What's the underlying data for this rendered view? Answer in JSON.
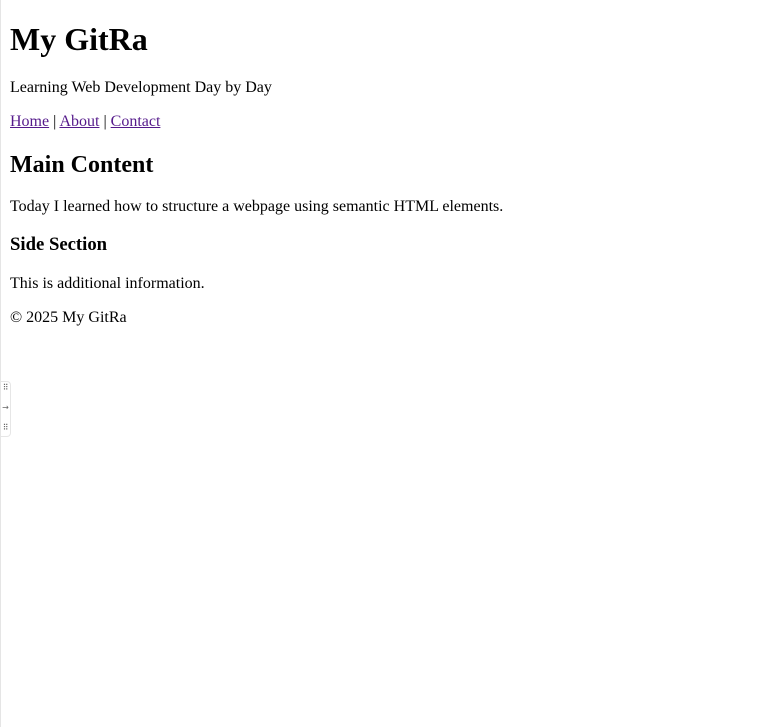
{
  "header": {
    "title": "My GitRa",
    "tagline": "Learning Web Development Day by Day"
  },
  "nav": {
    "links": [
      {
        "label": "Home"
      },
      {
        "label": "About"
      },
      {
        "label": "Contact"
      }
    ],
    "separator": "|"
  },
  "main": {
    "heading": "Main Content",
    "text": "Today I learned how to structure a webpage using semantic HTML elements."
  },
  "aside": {
    "heading": "Side Section",
    "text": "This is additional information."
  },
  "footer": {
    "text": "© 2025 My GitRa"
  },
  "edge_handle": {
    "icons": [
      "grip-icon",
      "arrow-right-icon",
      "grip-icon"
    ]
  },
  "colors": {
    "link_visited": "#551a8b",
    "text": "#000000",
    "background": "#ffffff"
  }
}
